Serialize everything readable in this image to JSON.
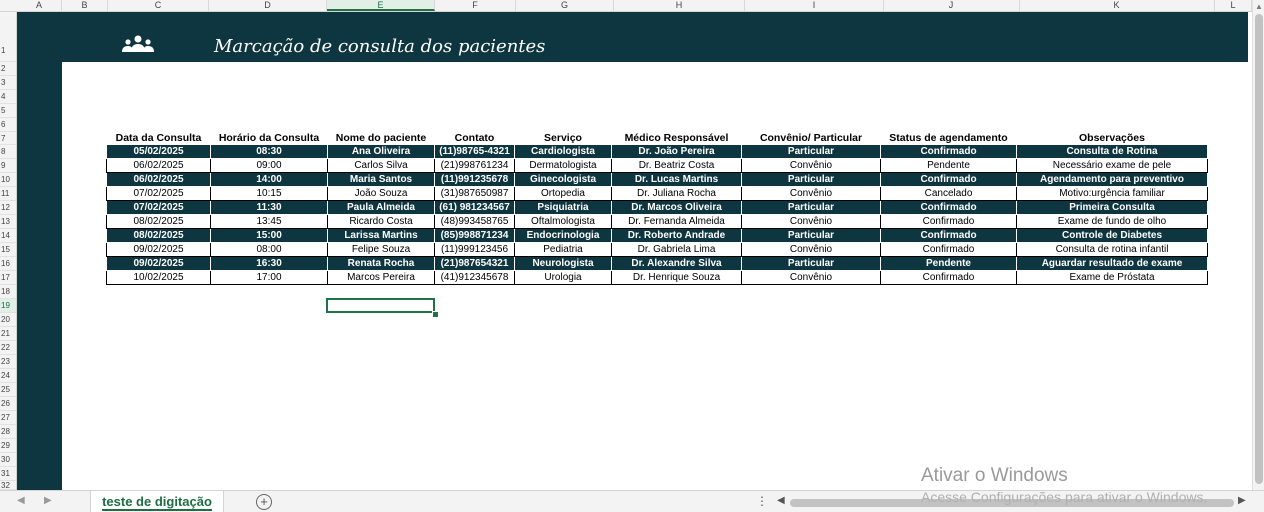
{
  "columns": [
    "A",
    "B",
    "C",
    "D",
    "E",
    "F",
    "G",
    "H",
    "I",
    "J",
    "K",
    "L"
  ],
  "selected_column": "E",
  "rows": [
    "1",
    "2",
    "3",
    "4",
    "5",
    "6",
    "7",
    "8",
    "9",
    "10",
    "11",
    "12",
    "13",
    "14",
    "15",
    "16",
    "17",
    "18",
    "19",
    "20",
    "21",
    "22",
    "23",
    "24",
    "25",
    "26",
    "27",
    "28",
    "29",
    "30",
    "31",
    "32"
  ],
  "selected_row": "19",
  "sheet": {
    "title": "Marcação de consulta dos pacientes",
    "logo_icon": "users-icon",
    "colors": {
      "banner": "#0e3640",
      "accent": "#217346",
      "header_text": "#ffffff"
    }
  },
  "table": {
    "headers": [
      "Data da Consulta",
      "Horário da Consulta",
      "Nome do paciente",
      "Contato",
      "Serviço",
      "Médico Responsável",
      "Convênio/ Particular",
      "Status de agendamento",
      "Observações"
    ],
    "rows": [
      [
        "05/02/2025",
        "08:30",
        "Ana Oliveira",
        "(11)98765-4321",
        "Cardiologista",
        "Dr. João Pereira",
        "Particular",
        "Confirmado",
        "Consulta de Rotina"
      ],
      [
        "06/02/2025",
        "09:00",
        "Carlos Silva",
        "(21)998761234",
        "Dermatologista",
        "Dr. Beatriz Costa",
        "Convênio",
        "Pendente",
        "Necessário exame de pele"
      ],
      [
        "06/02/2025",
        "14:00",
        "Maria Santos",
        "(11)991235678",
        "Ginecologista",
        "Dr. Lucas Martins",
        "Particular",
        "Confirmado",
        "Agendamento para preventivo"
      ],
      [
        "07/02/2025",
        "10:15",
        "João Souza",
        "(31)987650987",
        "Ortopedia",
        "Dr. Juliana Rocha",
        "Convênio",
        "Cancelado",
        "Motivo:urgência familiar"
      ],
      [
        "07/02/2025",
        "11:30",
        "Paula Almeida",
        "(61) 981234567",
        "Psiquiatria",
        "Dr. Marcos Oliveira",
        "Particular",
        "Confirmado",
        "Primeira Consulta"
      ],
      [
        "08/02/2025",
        "13:45",
        "Ricardo Costa",
        "(48)993458765",
        "Oftalmologista",
        "Dr. Fernanda Almeida",
        "Convênio",
        "Confirmado",
        "Exame de fundo de olho"
      ],
      [
        "08/02/2025",
        "15:00",
        "Larissa Martins",
        "(85)998871234",
        "Endocrinologia",
        "Dr. Roberto Andrade",
        "Particular",
        "Confirmado",
        "Controle de Diabetes"
      ],
      [
        "09/02/2025",
        "08:00",
        "Felipe Souza",
        "(11)999123456",
        "Pediatria",
        "Dr. Gabriela Lima",
        "Convênio",
        "Confirmado",
        "Consulta de rotina infantil"
      ],
      [
        "09/02/2025",
        "16:30",
        "Renata Rocha",
        "(21)987654321",
        "Neurologista",
        "Dr. Alexandre Silva",
        "Particular",
        "Pendente",
        "Aguardar resultado de exame"
      ],
      [
        "10/02/2025",
        "17:00",
        "Marcos Pereira",
        "(41)912345678",
        "Urologia",
        "Dr. Henrique Souza",
        "Convênio",
        "Confirmado",
        "Exame de Próstata"
      ]
    ]
  },
  "tabs": {
    "active_sheet": "teste de digitação",
    "add_sheet_label": "+"
  },
  "watermark": {
    "title": "Ativar o Windows",
    "subtitle": "Acesse Configurações para ativar o Windows."
  }
}
